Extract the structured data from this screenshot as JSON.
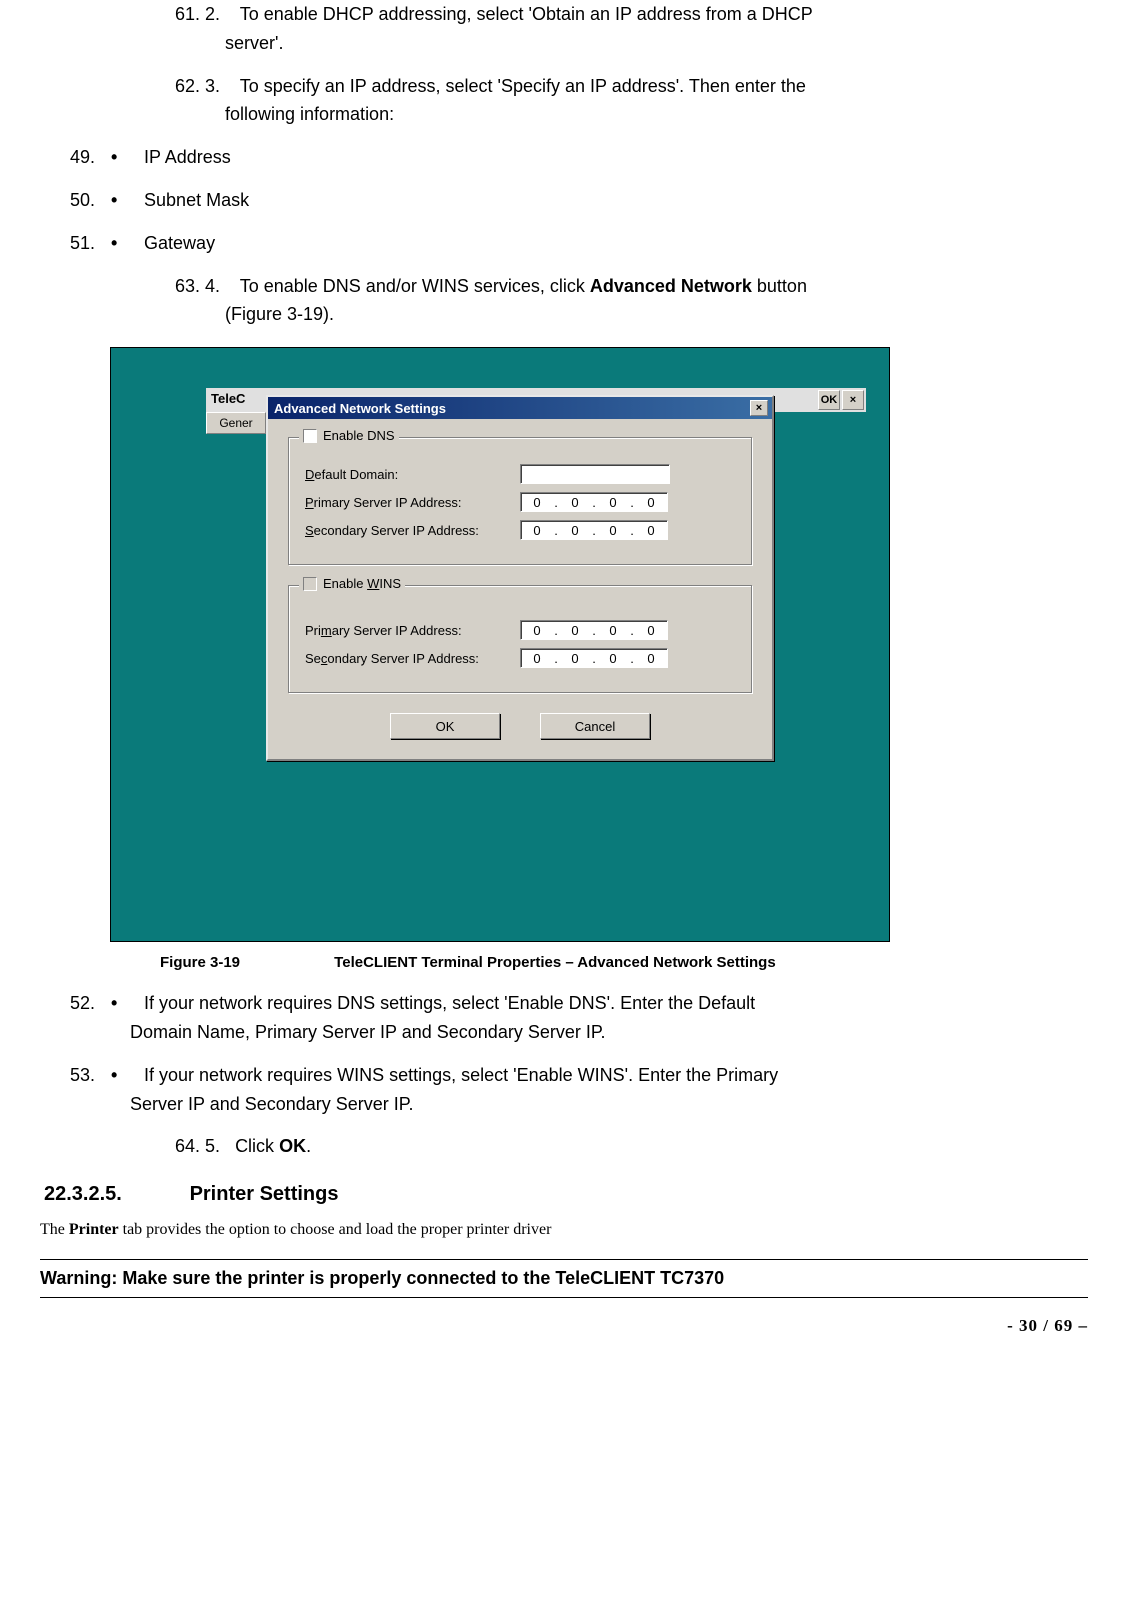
{
  "steps": {
    "s61": {
      "num": "61. 2.",
      "text": "To enable DHCP addressing, select 'Obtain an IP address from a DHCP",
      "cont": "server'."
    },
    "s62": {
      "num": "62. 3.",
      "text": "To specify an IP address, select 'Specify an IP address'. Then enter the",
      "cont": "following information:"
    },
    "b49": {
      "num": "49.",
      "text": "IP Address"
    },
    "b50": {
      "num": "50.",
      "text": "Subnet Mask"
    },
    "b51": {
      "num": "51.",
      "text": "Gateway"
    },
    "s63a": {
      "num": "63. 4.",
      "text_pre": "To enable DNS and/or WINS services, click ",
      "text_bold": "Advanced Network",
      "text_post": " button",
      "cont": "(Figure 3-19)."
    },
    "b52": {
      "num": "52.",
      "text": "If your network requires DNS settings, select 'Enable DNS'.  Enter the Default",
      "cont": "Domain Name, Primary Server IP and Secondary Server IP."
    },
    "b53": {
      "num": "53.",
      "text": "If your network requires WINS settings, select 'Enable WINS'.  Enter the Primary",
      "cont": "Server IP and Secondary Server IP."
    },
    "s64": {
      "num": "64. 5.",
      "text_pre": "Click ",
      "text_bold": "OK",
      "text_post": "."
    }
  },
  "figure": {
    "num": "Figure 3-19",
    "caption": "TeleCLIENT Terminal Properties – Advanced Network Settings"
  },
  "heading": {
    "num": "22.3.2.5.",
    "text": "Printer Settings"
  },
  "body": {
    "printer_pre": "The ",
    "printer_bold": "Printer",
    "printer_post": " tab provides the option to choose and load the proper printer driver"
  },
  "warning": "Warning:  Make sure the printer is properly connected to the TeleCLIENT TC7370",
  "pagenum": "- 30 / 69 –",
  "dialog": {
    "bg_label": "TeleC",
    "bg_tab": "Gener",
    "bg_ok": "OK",
    "bg_x": "×",
    "title": "Advanced Network Settings",
    "close": "×",
    "dns": {
      "legend": "Enable DNS",
      "domain_label_pre": "",
      "domain_label_u": "D",
      "domain_label_post": "efault Domain:",
      "primary_label_pre": "",
      "primary_label_u": "P",
      "primary_label_post": "rimary Server IP Address:",
      "secondary_label_pre": "",
      "secondary_label_u": "S",
      "secondary_label_post": "econdary Server IP Address:",
      "primary_ip": [
        "0",
        "0",
        "0",
        "0"
      ],
      "secondary_ip": [
        "0",
        "0",
        "0",
        "0"
      ]
    },
    "wins": {
      "legend_pre": "Enable ",
      "legend_u": "W",
      "legend_post": "INS",
      "primary_label_pre": "Pri",
      "primary_label_u": "m",
      "primary_label_post": "ary Server IP Address:",
      "secondary_label_pre": "Se",
      "secondary_label_u": "c",
      "secondary_label_post": "ondary Server IP Address:",
      "primary_ip": [
        "0",
        "0",
        "0",
        "0"
      ],
      "secondary_ip": [
        "0",
        "0",
        "0",
        "0"
      ]
    },
    "ok": "OK",
    "cancel": "Cancel"
  }
}
